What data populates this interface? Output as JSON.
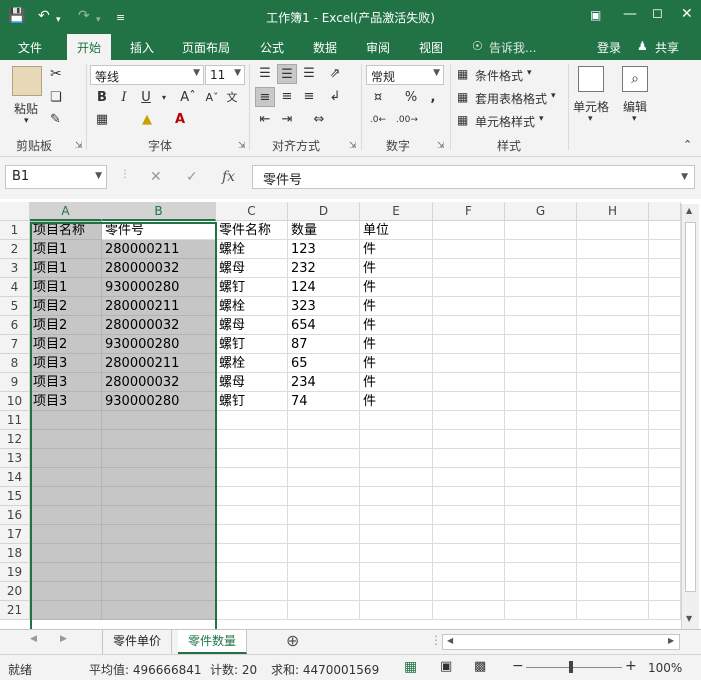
{
  "window": {
    "title": "工作簿1 - Excel(产品激活失败)"
  },
  "tabs": [
    "文件",
    "开始",
    "插入",
    "页面布局",
    "公式",
    "数据",
    "审阅",
    "视图"
  ],
  "tellme": "告诉我...",
  "signin": "登录",
  "share": "共享",
  "ribbon": {
    "paste": "粘贴",
    "clipboard": "剪贴板",
    "font_name": "等线",
    "font_size": "11",
    "font_group": "字体",
    "align_group": "对齐方式",
    "number_format": "常规",
    "number_group": "数字",
    "cond_format": "条件格式",
    "table_format": "套用表格格式",
    "cell_style": "单元格样式",
    "styles_group": "样式",
    "cells": "单元格",
    "editing": "编辑",
    "bold": "B",
    "italic": "I",
    "underline": "U"
  },
  "formula_bar": {
    "name_box": "B1",
    "content": "零件号",
    "fx": "fx"
  },
  "columns": [
    "A",
    "B",
    "C",
    "D",
    "E",
    "F",
    "G",
    "H"
  ],
  "rows": [
    "1",
    "2",
    "3",
    "4",
    "5",
    "6",
    "7",
    "8",
    "9",
    "10",
    "11",
    "12",
    "13",
    "14",
    "15",
    "16",
    "17",
    "18",
    "19",
    "20",
    "21"
  ],
  "cells": [
    [
      "项目名称",
      "零件号",
      "零件名称",
      "数量",
      "单位"
    ],
    [
      "项目1",
      "280000211",
      "螺栓",
      "123",
      "件"
    ],
    [
      "项目1",
      "280000032",
      "螺母",
      "232",
      "件"
    ],
    [
      "项目1",
      "930000280",
      "螺钉",
      "124",
      "件"
    ],
    [
      "项目2",
      "280000211",
      "螺栓",
      "323",
      "件"
    ],
    [
      "项目2",
      "280000032",
      "螺母",
      "654",
      "件"
    ],
    [
      "项目2",
      "930000280",
      "螺钉",
      "87",
      "件"
    ],
    [
      "项目3",
      "280000211",
      "螺栓",
      "65",
      "件"
    ],
    [
      "项目3",
      "280000032",
      "螺母",
      "234",
      "件"
    ],
    [
      "项目3",
      "930000280",
      "螺钉",
      "74",
      "件"
    ]
  ],
  "sheets": [
    "零件单价",
    "零件数量"
  ],
  "active_sheet": "零件数量",
  "status": {
    "mode": "就绪",
    "average": "平均值: 496666841",
    "count": "计数: 20",
    "sum": "求和: 4470001569",
    "zoom": "100%"
  },
  "colors": {
    "accent": "#217346",
    "selection": "#c6c6c6"
  },
  "icons": [
    "save-icon",
    "undo-icon",
    "redo-icon",
    "customize-icon",
    "ribbon-display-icon",
    "minimize-icon",
    "maximize-icon",
    "close-icon",
    "lightbulb-icon",
    "person-icon",
    "cut-icon",
    "copy-icon",
    "format-painter-icon",
    "border-icon",
    "fill-color-icon",
    "font-color-icon",
    "search-icon",
    "plus-icon"
  ]
}
